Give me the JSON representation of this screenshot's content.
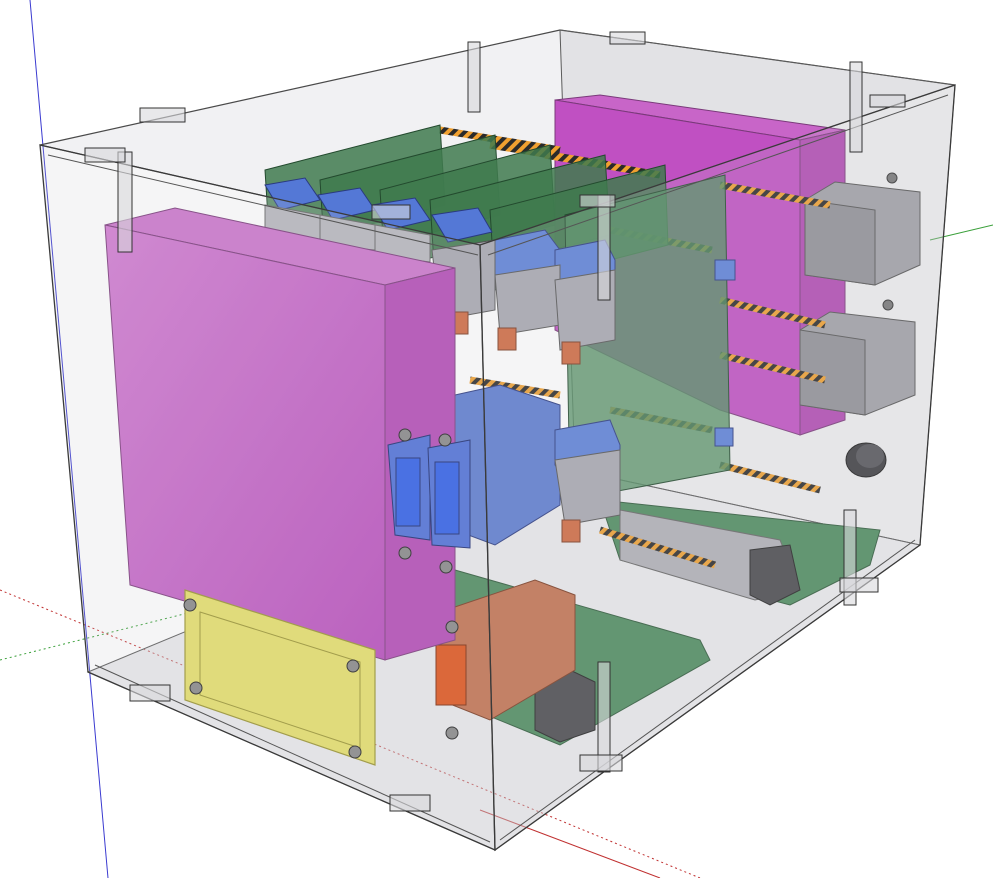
{
  "scene": {
    "colors": {
      "background": "#ffffff",
      "enclosure_glass": "#9a9aa0",
      "enclosure_edge": "#3a3a3a",
      "axis_blue": "#3a3ad0",
      "axis_red": "#c03030",
      "axis_green": "#3aa03a",
      "magenta_module": "#c25ec4",
      "yellow_plate": "#e6e06a",
      "pcb_green": "#3f7a4e",
      "blue_connector": "#5478d6",
      "bright_blue_socket": "#2f5fe8",
      "orange_connector": "#c07048",
      "gray_block": "#909096",
      "dark_block": "#4a4a4e",
      "standoff_orange": "#f0a030",
      "standoff_stripe": "#2a2a2a"
    },
    "icons": {
      "knob": "rotary-knob-icon"
    }
  }
}
